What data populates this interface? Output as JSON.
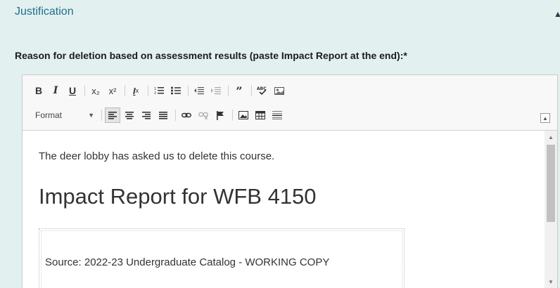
{
  "section": {
    "title": "Justification"
  },
  "field": {
    "label": "Reason for deletion based on assessment results (paste Impact Report at the end):",
    "required_mark": "*"
  },
  "toolbar": {
    "bold": "B",
    "italic": "I",
    "underline": "U",
    "subscript": "x₂",
    "superscript": "x²",
    "remove_format": "Ix",
    "numbered_list": "⒈",
    "bulleted_list": "•≡",
    "decrease_indent": "⇤",
    "increase_indent": "⇥",
    "blockquote": "99",
    "spellcheck": "ABC",
    "image_tool": "▣",
    "format_label": "Format",
    "link": "⛓",
    "unlink": "⛓",
    "anchor": "⚑",
    "image": "▧",
    "table": "⊞",
    "horizontal_rule": "≡"
  },
  "content": {
    "paragraph": "The deer lobby has asked us to delete this course.",
    "heading": "Impact Report for WFB 4150",
    "source_line": "Source: 2022-23 Undergraduate Catalog - WORKING COPY"
  },
  "colors": {
    "accent": "#1f6f8b",
    "background": "#e3f0f0"
  }
}
